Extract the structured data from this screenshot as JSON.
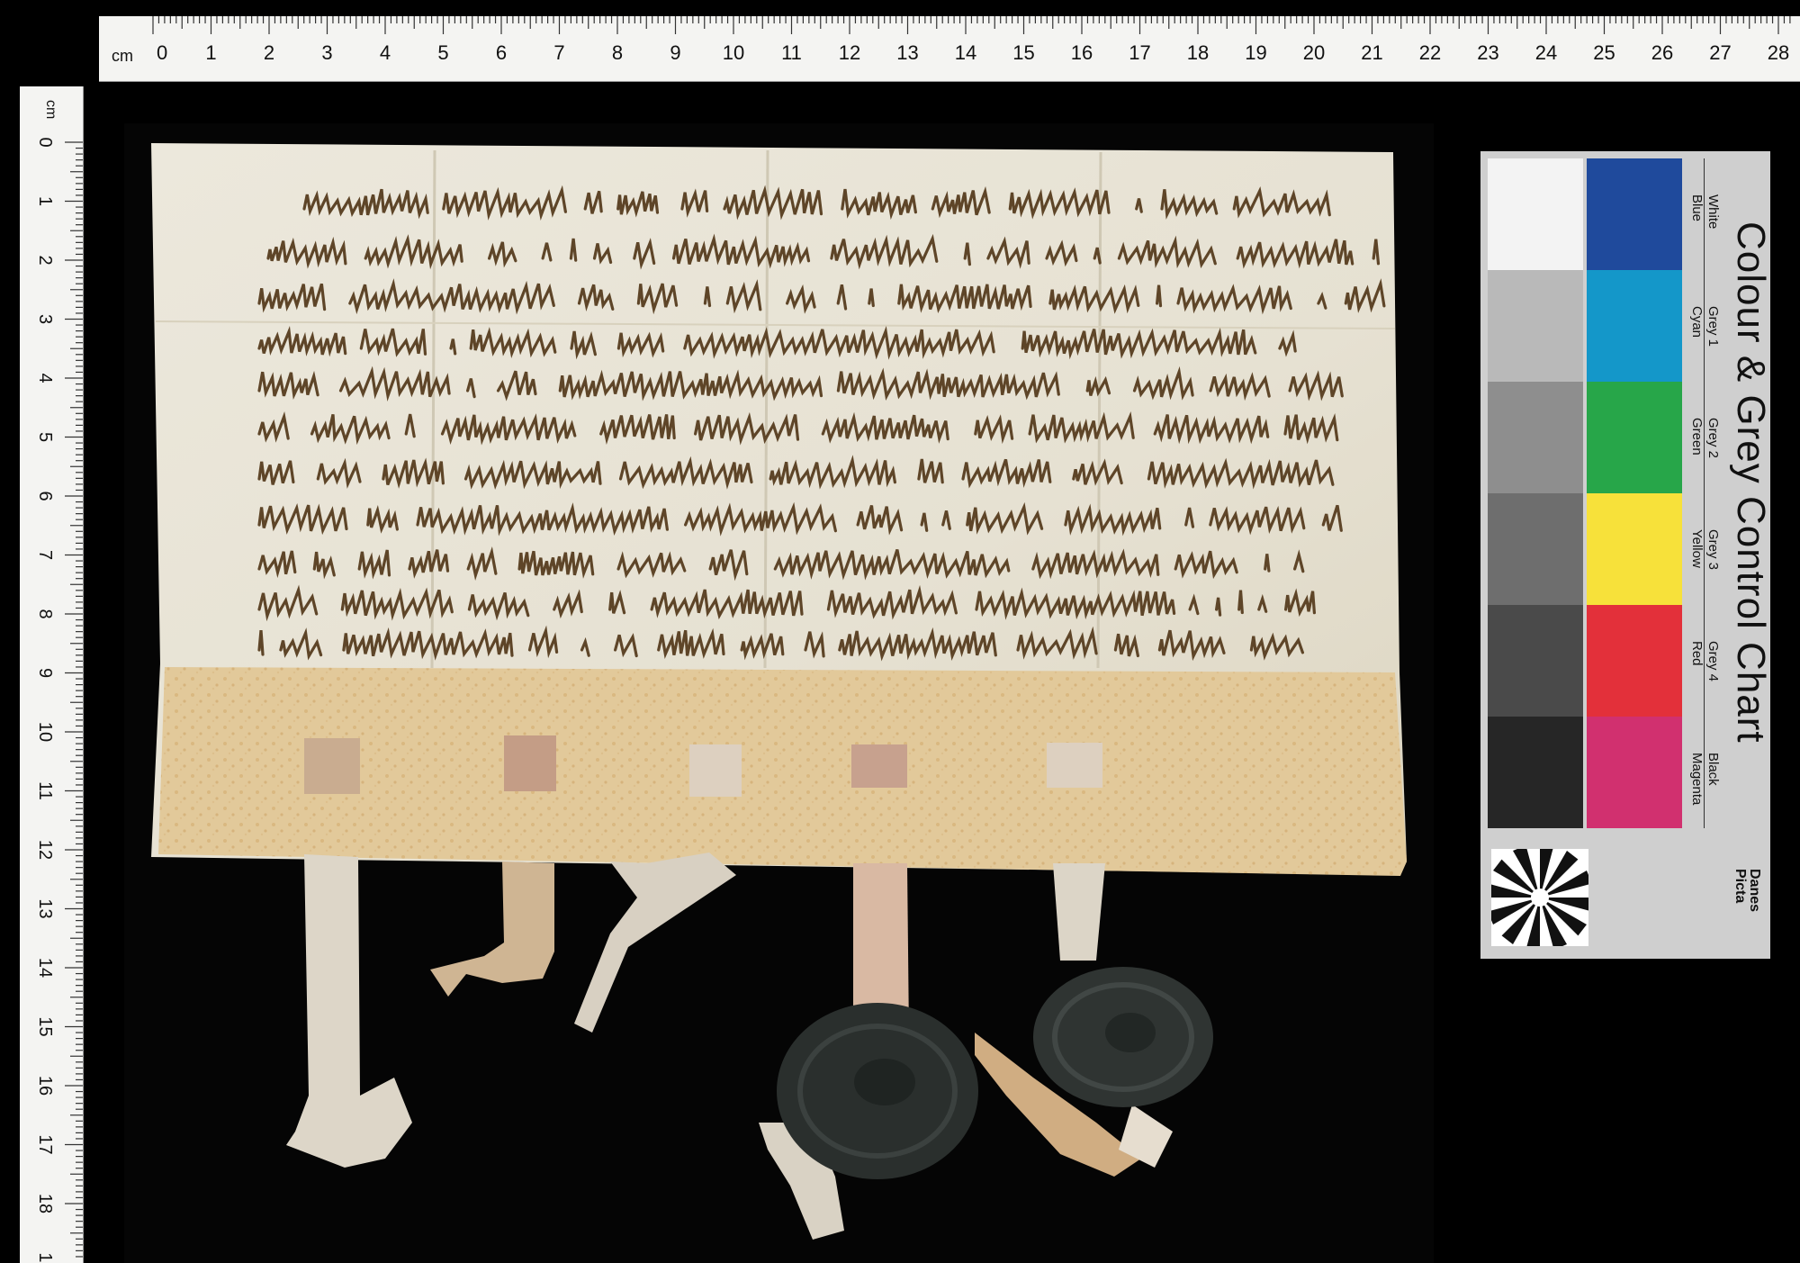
{
  "ruler": {
    "unit": "cm",
    "top_numbers": [
      "0",
      "1",
      "2",
      "3",
      "4",
      "5",
      "6",
      "7",
      "8",
      "9",
      "10",
      "11",
      "12",
      "13",
      "14",
      "15",
      "16",
      "17",
      "18",
      "19",
      "20",
      "21",
      "22",
      "23",
      "24",
      "25",
      "26",
      "27",
      "28"
    ],
    "left_numbers": [
      "0",
      "1",
      "2",
      "3",
      "4",
      "5",
      "6",
      "7",
      "8",
      "9",
      "10",
      "11",
      "12",
      "13",
      "14",
      "15",
      "16",
      "17",
      "18",
      "19"
    ]
  },
  "colour_chart": {
    "title": "Colour & Grey Control Chart",
    "brand": [
      "Danes",
      "Picta"
    ],
    "grey_labels": [
      "White",
      "Grey 1",
      "Grey 2",
      "Grey 3",
      "Grey 4",
      "Black"
    ],
    "colour_labels": [
      "Blue",
      "Cyan",
      "Green",
      "Yellow",
      "Red",
      "Magenta"
    ],
    "grey_colors": [
      "#f3f3f3",
      "#b9b9b9",
      "#8e8e8e",
      "#6e6e6e",
      "#4a4a4a",
      "#262626"
    ],
    "colour_colors": [
      "#1f4a9c",
      "#1497c9",
      "#27a649",
      "#f7e13a",
      "#e3303a",
      "#d1306f"
    ]
  },
  "document": {
    "parchment_color": "#e9e4d6",
    "fold_color": "#e2c99a",
    "seal_color": "#2a2f2d"
  }
}
